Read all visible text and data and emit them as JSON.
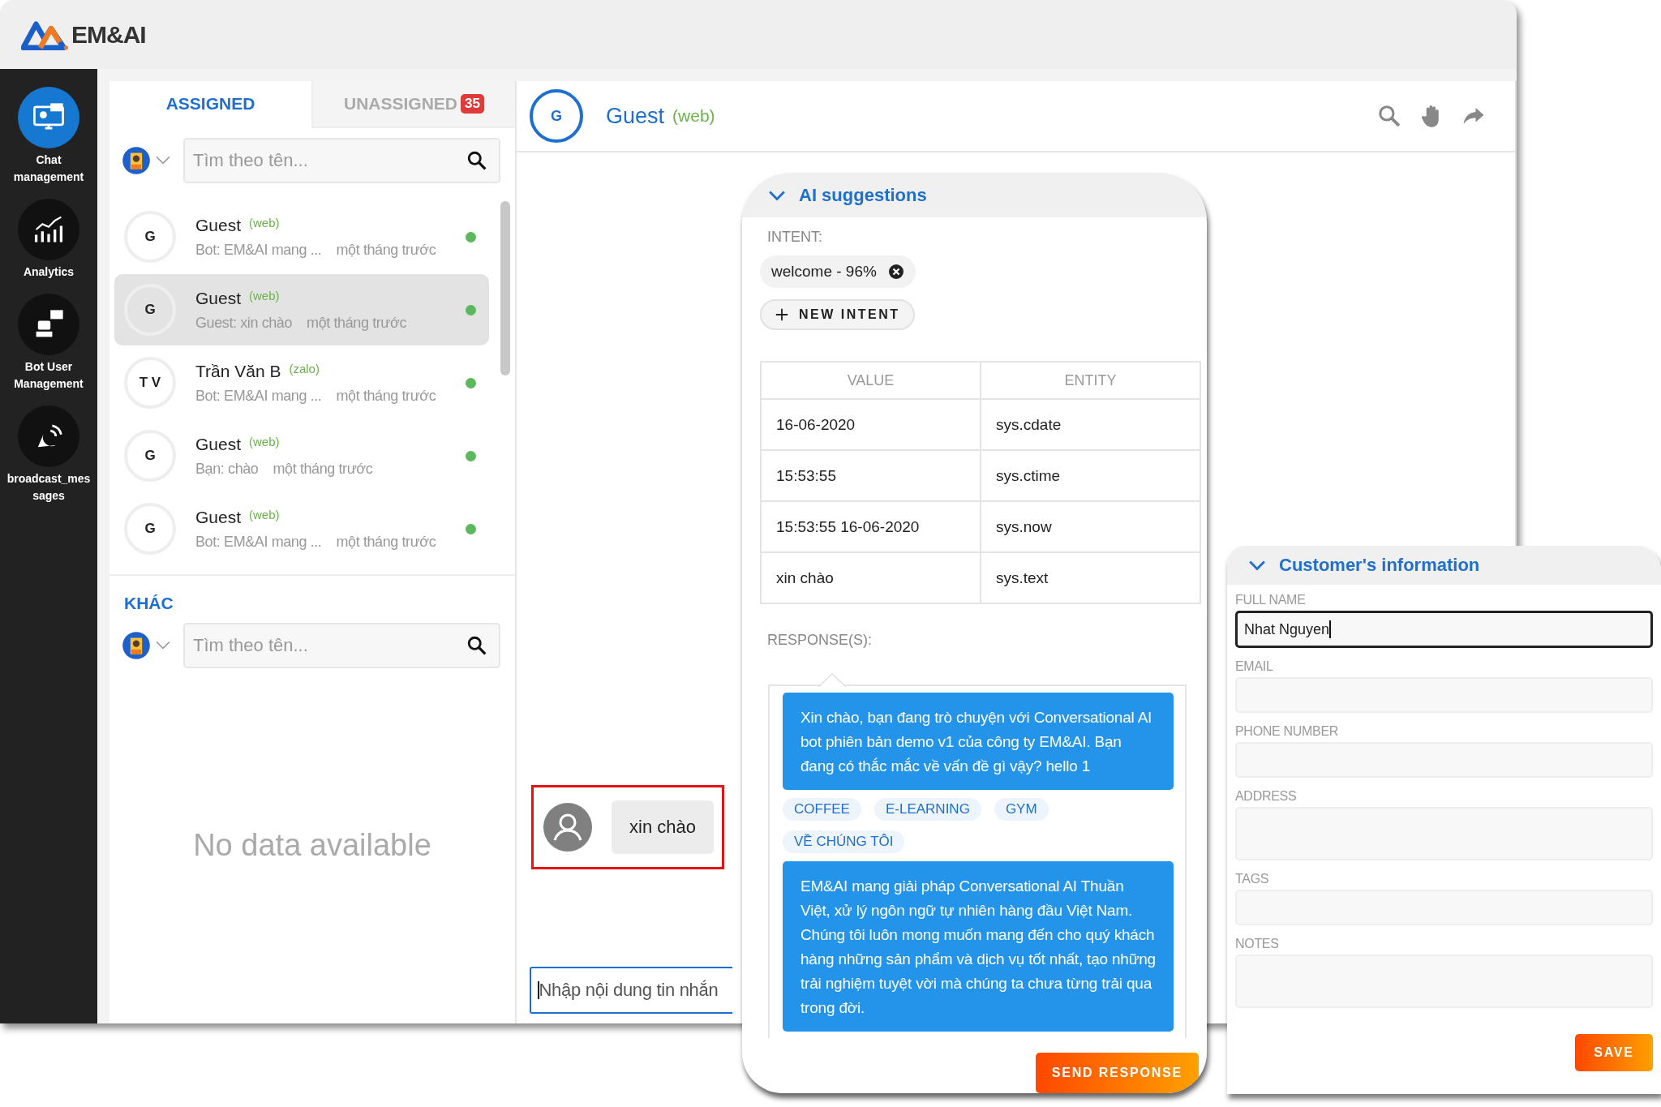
{
  "brand": {
    "name": "EM&AI"
  },
  "nav": [
    {
      "kind": "chat",
      "label": "Chat management",
      "selected": true
    },
    {
      "kind": "analytics",
      "label": "Analytics",
      "selected": false
    },
    {
      "kind": "bot",
      "label": "Bot User Management",
      "selected": false
    },
    {
      "kind": "broadcast",
      "label": "broadcast_messages",
      "selected": false
    }
  ],
  "tabs": [
    {
      "label": "ASSIGNED",
      "selected": true
    },
    {
      "label": "UNASSIGNED",
      "selected": false,
      "badge": "35"
    }
  ],
  "search": {
    "placeholder": "Tìm theo tên..."
  },
  "conversations": [
    {
      "initials": "G",
      "name": "Guest",
      "channel": "(web)",
      "preview": "Bot: EM&AI mang ...",
      "time": "một tháng trước",
      "selected": false,
      "online": true
    },
    {
      "initials": "G",
      "name": "Guest",
      "channel": "(web)",
      "preview": "Guest: xin chào",
      "time": "một tháng trước",
      "selected": true,
      "online": true
    },
    {
      "initials": "T V",
      "name": "Trần Văn B",
      "channel": "(zalo)",
      "preview": "Bot: EM&AI mang ...",
      "time": "một tháng trước",
      "selected": false,
      "online": true
    },
    {
      "initials": "G",
      "name": "Guest",
      "channel": "(web)",
      "preview": "Bạn: chào",
      "time": "một tháng trước",
      "selected": false,
      "online": true
    },
    {
      "initials": "G",
      "name": "Guest",
      "channel": "(web)",
      "preview": "Bot: EM&AI mang ...",
      "time": "một tháng trước",
      "selected": false,
      "online": true
    }
  ],
  "other": {
    "title": "KHÁC",
    "search": {
      "placeholder": "Tìm theo tên..."
    },
    "empty": "No data available"
  },
  "chat": {
    "avatar": "G",
    "name": "Guest",
    "channel": "(web)",
    "messages": [
      {
        "text": "xin chào",
        "highlighted": true
      }
    ],
    "input": {
      "placeholder": "Nhập nội dung tin nhắn"
    }
  },
  "ai_suggestions": {
    "title": "AI suggestions",
    "expanded": true,
    "intent_label": "INTENT:",
    "intents": [
      "welcome - 96%"
    ],
    "new_intent": "NEW INTENT",
    "table": {
      "columns": [
        "VALUE",
        "ENTITY"
      ],
      "rows": [
        [
          "16-06-2020",
          "sys.cdate"
        ],
        [
          "15:53:55",
          "sys.ctime"
        ],
        [
          "15:53:55 16-06-2020",
          "sys.now"
        ],
        [
          "xin chào",
          "sys.text"
        ]
      ]
    },
    "responses_label": "RESPONSE(S):",
    "responses": [
      {
        "kind": "text",
        "text": "Xin chào, bạn đang trò chuyện với Conversational AI bot phiên bản demo v1 của công ty EM&AI. Bạn đang có thắc mắc về vấn đề gì vậy? hello 1"
      },
      {
        "kind": "quick_replies",
        "items": [
          "COFFEE",
          "E-LEARNING",
          "GYM",
          "VỀ CHÚNG TÔI"
        ]
      },
      {
        "kind": "text",
        "text": "EM&AI mang giải pháp Conversational AI Thuần Việt, xử lý ngôn ngữ tự nhiên hàng đầu Việt Nam. Chúng tôi luôn mong muốn mang đến cho quý khách hàng những sản phẩm và dịch vụ tốt nhất, tạo những trải nghiệm tuyệt vời mà chúng ta chưa từng trải qua trong đời."
      }
    ],
    "send": "SEND RESPONSE"
  },
  "customer_info": {
    "title": "Customer's information",
    "expanded": true,
    "fields": [
      {
        "kind": "line",
        "label": "FULL NAME",
        "value": "Nhat Nguyen",
        "focused": true
      },
      {
        "kind": "line",
        "label": "EMAIL",
        "focused": false
      },
      {
        "kind": "line",
        "label": "PHONE NUMBER",
        "focused": false
      },
      {
        "kind": "area",
        "label": "ADDRESS",
        "focused": false
      },
      {
        "kind": "line",
        "label": "TAGS",
        "focused": false
      },
      {
        "kind": "area",
        "label": "NOTES",
        "focused": false
      }
    ],
    "save": "SAVE"
  }
}
